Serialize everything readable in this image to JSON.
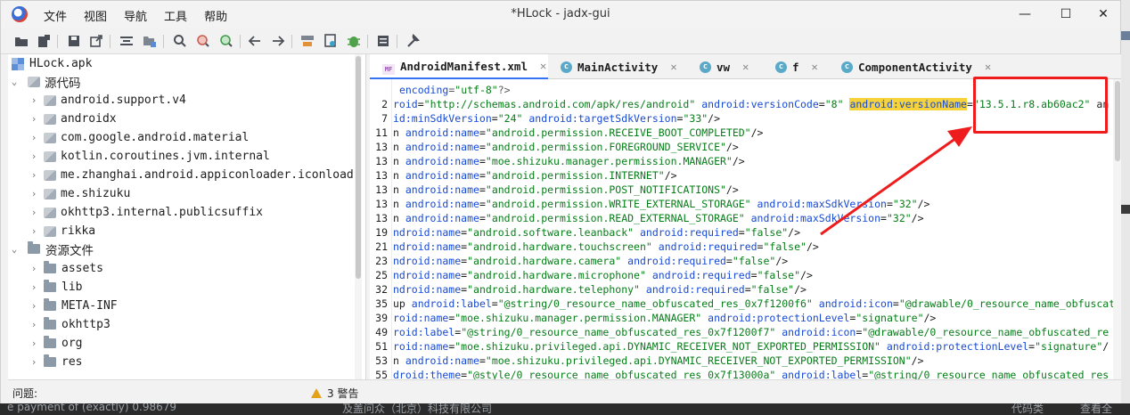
{
  "window": {
    "title": "*HLock - jadx-gui"
  },
  "menu": {
    "items": [
      "文件",
      "视图",
      "导航",
      "工具",
      "帮助"
    ]
  },
  "toolbar": {
    "icons": [
      "open-file-icon",
      "add-files-icon",
      "save-icon",
      "export-icon",
      "sync-icon",
      "flatten-packages-icon",
      "search-icon",
      "find-class-icon",
      "find-usage-icon",
      "back-icon",
      "forward-icon",
      "deobfuscation-icon",
      "quark-icon",
      "debugger-icon",
      "log-icon",
      "preferences-icon"
    ]
  },
  "tree": {
    "root": "HLock.apk",
    "source_node": "源代码",
    "packages": [
      "android.support.v4",
      "androidx",
      "com.google.android.material",
      "kotlin.coroutines.jvm.internal",
      "me.zhanghai.android.appiconloader.iconload",
      "me.shizuku",
      "okhttp3.internal.publicsuffix",
      "rikka"
    ],
    "resources_node": "资源文件",
    "resources": [
      "assets",
      "lib",
      "META-INF",
      "okhttp3",
      "org",
      "res"
    ]
  },
  "tabs": [
    {
      "label": "AndroidManifest.xml",
      "icon": "manifest-icon",
      "active": true
    },
    {
      "label": "MainActivity",
      "icon": "class-icon",
      "active": false
    },
    {
      "label": "vw",
      "icon": "class-icon",
      "active": false
    },
    {
      "label": "f",
      "icon": "class-icon",
      "active": false
    },
    {
      "label": "ComponentActivity",
      "icon": "class-icon",
      "active": false
    }
  ],
  "code": {
    "line_numbers": [
      "",
      "2",
      "7",
      "11",
      "13",
      "13",
      "13",
      "13",
      "13",
      "13",
      "19",
      "21",
      "23",
      "25",
      "32",
      "35",
      "39",
      "49",
      "51",
      "53",
      "55",
      "61",
      "79"
    ],
    "lines": [
      " encoding=\"utf-8\"?>",
      "roid=\"http://schemas.android.com/apk/res/android\" android:versionCode=\"8\" android:versionName=\"13.5.1.r8.ab60ac2\" an",
      "id:minSdkVersion=\"24\" android:targetSdkVersion=\"33\"/>",
      "n android:name=\"android.permission.RECEIVE_BOOT_COMPLETED\"/>",
      "n android:name=\"android.permission.FOREGROUND_SERVICE\"/>",
      "n android:name=\"moe.shizuku.manager.permission.MANAGER\"/>",
      "n android:name=\"android.permission.INTERNET\"/>",
      "n android:name=\"android.permission.POST_NOTIFICATIONS\"/>",
      "n android:name=\"android.permission.WRITE_EXTERNAL_STORAGE\" android:maxSdkVersion=\"32\"/>",
      "n android:name=\"android.permission.READ_EXTERNAL_STORAGE\" android:maxSdkVersion=\"32\"/>",
      "ndroid:name=\"android.software.leanback\" android:required=\"false\"/>",
      "ndroid:name=\"android.hardware.touchscreen\" android:required=\"false\"/>",
      "ndroid:name=\"android.hardware.camera\" android:required=\"false\"/>",
      "ndroid:name=\"android.hardware.microphone\" android:required=\"false\"/>",
      "ndroid:name=\"android.hardware.telephony\" android:required=\"false\"/>",
      "up android:label=\"@string/0_resource_name_obfuscated_res_0x7f1200f6\" android:icon=\"@drawable/0_resource_name_obfuscat",
      "roid:name=\"moe.shizuku.manager.permission.MANAGER\" android:protectionLevel=\"signature\"/>",
      "roid:label=\"@string/0_resource_name_obfuscated_res_0x7f1200f7\" android:icon=\"@drawable/0_resource_name_obfuscated_re",
      "roid:name=\"moe.shizuku.privileged.api.DYNAMIC_RECEIVER_NOT_EXPORTED_PERMISSION\" android:protectionLevel=\"signature\"/",
      "n android:name=\"moe.shizuku.privileged.api.DYNAMIC_RECEIVER_NOT_EXPORTED_PERMISSION\"/>",
      "droid:theme=\"@style/0_resource_name_obfuscated_res_0x7f13000a\" android:label=\"@string/0_resource_name_obfuscated_res",
      "roid:name=\"moe.shizuku.manager.MainActivity\" android:exported=\"true\" android:banner=\"@mipmap/0 resource name obfus"
    ],
    "highlight": "android:versionName"
  },
  "status": {
    "label": "问题:",
    "warnings": "3 警告"
  },
  "background_text": [
    "e payment of (exactly) 0.98679",
    "及盖问众（北京）科技有限公司",
    "代码类",
    "查看全"
  ],
  "colors": {
    "accent": "#3574f0",
    "highlight": "#f6d33b",
    "annotation": "#ee1c1c"
  }
}
